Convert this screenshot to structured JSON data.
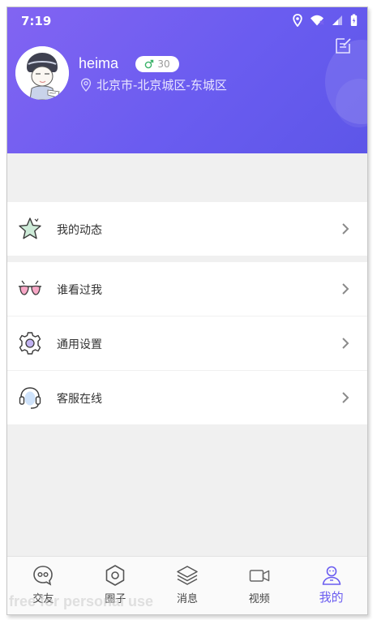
{
  "status_bar": {
    "time": "7:19"
  },
  "profile": {
    "username": "heima",
    "age": "30",
    "location": "北京市-北京城区-东城区"
  },
  "menu": {
    "group1": [
      {
        "label": "我的动态",
        "icon": "star-icon"
      }
    ],
    "group2": [
      {
        "label": "谁看过我",
        "icon": "glasses-icon"
      },
      {
        "label": "通用设置",
        "icon": "settings-gear-icon"
      },
      {
        "label": "客服在线",
        "icon": "headset-icon"
      }
    ]
  },
  "tabbar": {
    "tabs": [
      {
        "label": "交友",
        "icon": "chat-bubble-icon"
      },
      {
        "label": "圈子",
        "icon": "hexagon-icon"
      },
      {
        "label": "消息",
        "icon": "layers-icon"
      },
      {
        "label": "视频",
        "icon": "video-camera-icon"
      },
      {
        "label": "我的",
        "icon": "user-icon",
        "active": true
      }
    ]
  },
  "watermark": "free for personal use",
  "colors": {
    "accent": "#6a5cf0",
    "header_start": "#8264f2",
    "background": "#f0f0f0"
  }
}
